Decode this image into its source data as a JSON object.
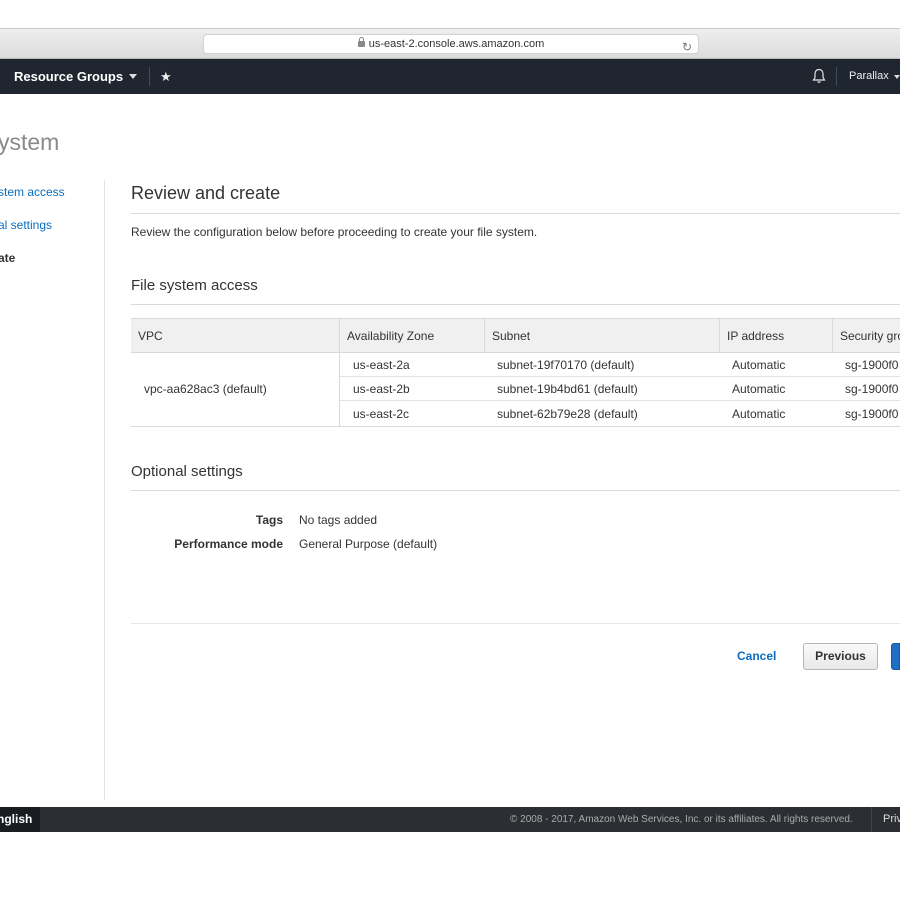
{
  "browser": {
    "url": "us-east-2.console.aws.amazon.com"
  },
  "nav": {
    "resource_groups": "Resource Groups",
    "pin": "★",
    "user": "Parallax"
  },
  "page": {
    "title": "ystem"
  },
  "steps": [
    {
      "label": "stem access",
      "state": "link"
    },
    {
      "label": "al settings",
      "state": "link"
    },
    {
      "label": "ate",
      "state": "current"
    }
  ],
  "review": {
    "heading": "Review and create",
    "description": "Review the configuration below before proceeding to create your file system."
  },
  "access": {
    "heading": "File system access",
    "columns": [
      "VPC",
      "Availability Zone",
      "Subnet",
      "IP address",
      "Security gro"
    ],
    "vpc": "vpc-aa628ac3 (default)",
    "rows": [
      {
        "az": "us-east-2a",
        "subnet": "subnet-19f70170 (default)",
        "ip": "Automatic",
        "sg": "sg-1900f0"
      },
      {
        "az": "us-east-2b",
        "subnet": "subnet-19b4bd61 (default)",
        "ip": "Automatic",
        "sg": "sg-1900f0"
      },
      {
        "az": "us-east-2c",
        "subnet": "subnet-62b79e28 (default)",
        "ip": "Automatic",
        "sg": "sg-1900f0"
      }
    ]
  },
  "optional": {
    "heading": "Optional settings",
    "tags_label": "Tags",
    "tags_value": "No tags added",
    "perf_label": "Performance mode",
    "perf_value": "General Purpose (default)"
  },
  "actions": {
    "cancel": "Cancel",
    "previous": "Previous"
  },
  "footer": {
    "language": "nglish",
    "copyright": "© 2008 - 2017, Amazon Web Services, Inc. or its affiliates. All rights reserved.",
    "privacy": "Priv"
  },
  "colors": {
    "nav_bg": "#1f262f",
    "link": "#0a6dc2",
    "primary_button": "#1f6fc6"
  }
}
